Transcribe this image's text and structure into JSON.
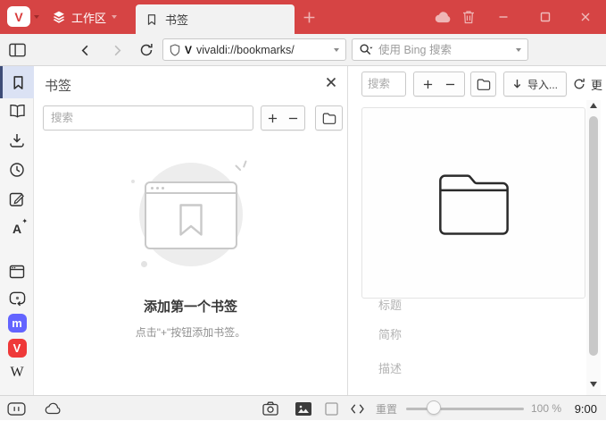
{
  "titlebar": {
    "vivaldi_glyph": "V",
    "workspace_label": "工作区",
    "tab_label": "书签"
  },
  "navbar": {
    "url": "vivaldi://bookmarks/",
    "site_icon_glyph": "V",
    "search_placeholder": "使用 Bing 搜索"
  },
  "sidebar": {
    "translate_glyph": "A",
    "translate_star": "✦",
    "mastodon_glyph": "m",
    "vivaldi_glyph": "V",
    "wikipedia_glyph": "W"
  },
  "panel": {
    "title": "书签",
    "search_placeholder": "搜索",
    "empty_title": "添加第一个书签",
    "empty_hint": "点击\"+\"按钮添加书签。"
  },
  "content": {
    "search_placeholder": "搜索",
    "import_label": "导入...",
    "more_label": "更",
    "title_placeholder": "标题",
    "nickname_placeholder": "简称",
    "description_placeholder": "描述"
  },
  "statusbar": {
    "reset_label": "重置",
    "zoom_level": "100 %",
    "time": "9:00"
  },
  "colors": {
    "titlebar_red": "#d64444",
    "chrome_gray": "#f2f2f2",
    "active_panel_bg": "#dbe2f4",
    "active_panel_bar": "#3d4c77",
    "mastodon_purple": "#6364ff",
    "vivaldi_icon_red": "#ef3939"
  }
}
